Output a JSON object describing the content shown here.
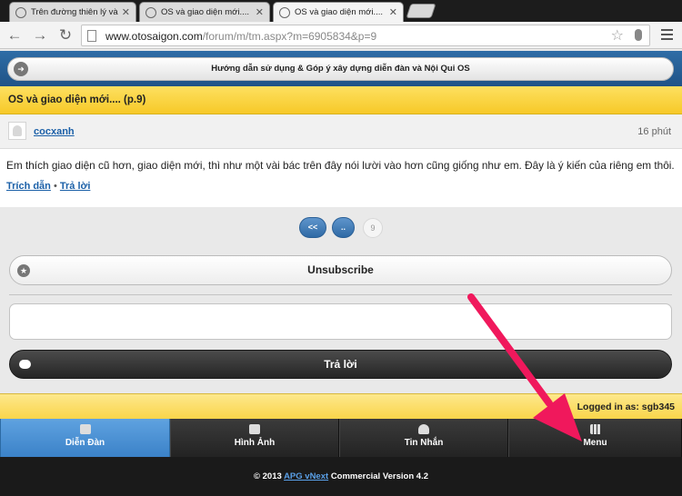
{
  "browser": {
    "tabs": [
      {
        "title": "Trên đường thiên lý và các"
      },
      {
        "title": "OS và giao diện mới...."
      },
      {
        "title": "OS và giao diện mới...."
      }
    ],
    "url_host": "www.otosaigon.com",
    "url_path": "/forum/m/tm.aspx?m=6905834&p=9"
  },
  "guide_link": "Hướng dẫn sử dụng & Góp ý xây dựng diễn đàn và Nội Qui OS",
  "thread_title": "OS và giao diện mới.... (p.9)",
  "post": {
    "author": "cocxanh",
    "time": "16 phút",
    "text": "Em thích giao diện cũ hơn, giao diện mới, thì như một vài bác trên đây nói lười vào hơn cũng  giống như em. Đây là ý kiến của riêng em thôi.",
    "quote_label": "Trích dẫn",
    "separator": "•",
    "reply_label": "Trả lời"
  },
  "pager": {
    "first": "<<",
    "prev": "..",
    "current": "9"
  },
  "unsubscribe_label": "Unsubscribe",
  "reply_button_label": "Trả lời",
  "logged_in": "Logged in as: sgb345",
  "nav": [
    {
      "label": "Diễn Đàn",
      "icon": "forum-icon"
    },
    {
      "label": "Hình Ảnh",
      "icon": "image-icon"
    },
    {
      "label": "Tin Nhắn",
      "icon": "inbox-icon"
    },
    {
      "label": "Menu",
      "icon": "grid-icon"
    }
  ],
  "footer": {
    "prefix": "© 2013",
    "link": "APG vNext",
    "suffix": "Commercial Version 4.2"
  },
  "colors": {
    "brand_blue": "#2f6da6",
    "title_yellow": "#f7c928",
    "arrow_pink": "#f0185c",
    "link_blue": "#1b60a8"
  }
}
